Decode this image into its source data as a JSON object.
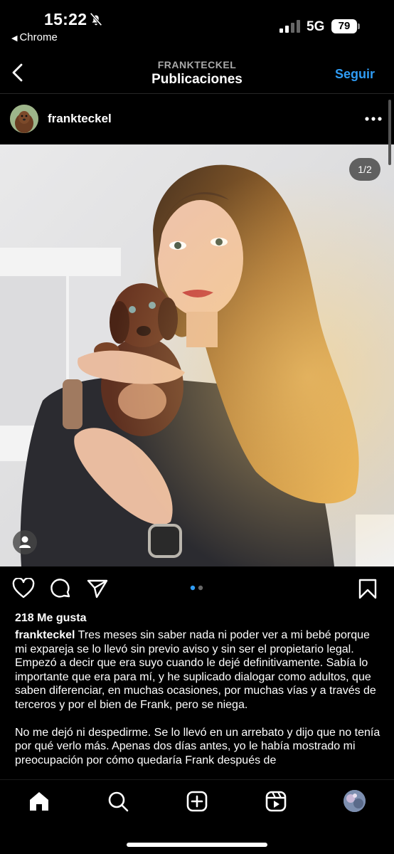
{
  "status": {
    "time": "15:22",
    "back_app": "Chrome",
    "network": "5G",
    "battery": "79"
  },
  "header": {
    "subtitle": "FRANKTECKEL",
    "title": "Publicaciones",
    "follow_label": "Seguir"
  },
  "post": {
    "username": "frankteckel",
    "image_counter": "1/2",
    "likes": "218 Me gusta",
    "caption_user": "frankteckel",
    "caption_text": " Tres meses sin saber nada ni poder ver a mi bebé porque mi expareja se lo llevó sin previo aviso y sin ser el propietario legal. Empezó a decir que era suyo cuando le dejé definitivamente. Sabía lo importante que era para mí, y he suplicado dialogar como adultos, que saben diferenciar, en muchas ocasiones, por muchas vías y a través de terceros y por el bien de Frank, pero se niega.",
    "caption_text_2": "No me dejó ni despedirme. Se lo llevó en un arrebato y dijo que no tenía por qué verlo más. Apenas dos días antes, yo le había mostrado mi preocupación por cómo quedaría Frank después de"
  },
  "colors": {
    "accent": "#2f9cf4",
    "background": "#000000",
    "text": "#ffffff"
  },
  "icons": {
    "like": "heart-icon",
    "comment": "comment-icon",
    "share": "send-icon",
    "save": "bookmark-icon",
    "nav": [
      "home-icon",
      "search-icon",
      "create-icon",
      "reels-icon",
      "profile-avatar"
    ]
  }
}
